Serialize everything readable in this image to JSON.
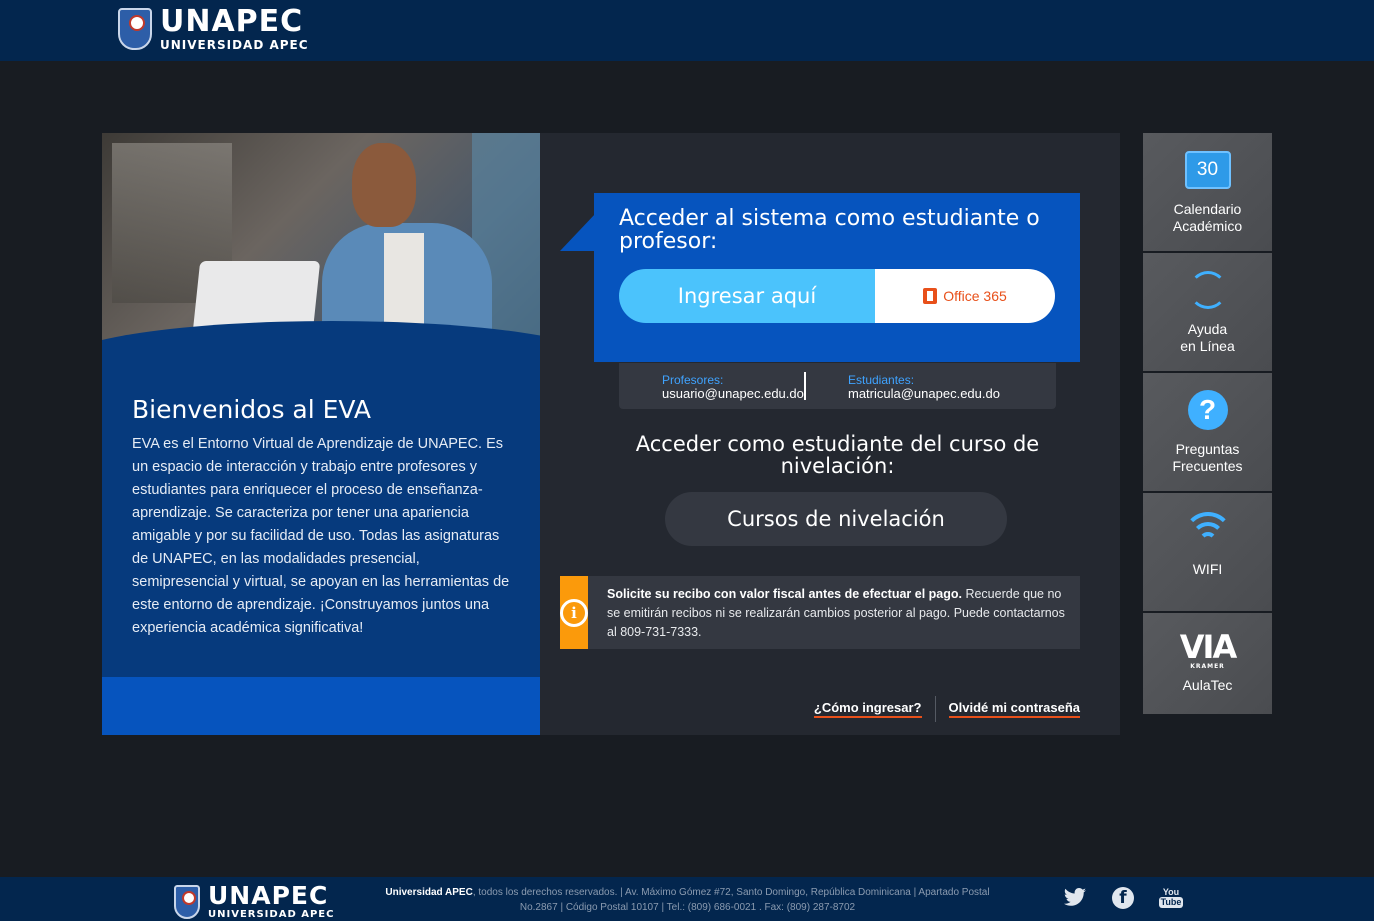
{
  "header": {
    "logo_big": "UNAPEC",
    "logo_small": "UNIVERSIDAD APEC"
  },
  "welcome": {
    "title": "Bienvenidos al EVA",
    "text": "EVA es el Entorno Virtual de Aprendizaje de UNAPEC. Es un espacio de interacción y trabajo entre profesores y estudiantes para enriquecer el proceso de enseñanza-aprendizaje. Se caracteriza por tener una apariencia amigable y por su facilidad de uso. Todas las asignaturas de UNAPEC, en las modalidades presencial, semipresencial y virtual, se apoyan en las herramientas de este entorno de aprendizaje. ¡Construyamos juntos una experiencia académica significativa!"
  },
  "login": {
    "title": "Acceder al sistema como estudiante o profesor:",
    "ingresar_label": "Ingresar aquí",
    "office_label": "Office 365",
    "hint_prof_label": "Profesores:",
    "hint_prof_value": "usuario@unapec.edu.do",
    "hint_est_label": "Estudiantes:",
    "hint_est_value": "matricula@unapec.edu.do"
  },
  "level": {
    "title": "Acceder como estudiante del curso de nivelación:",
    "button_label": "Cursos de nivelación"
  },
  "notice": {
    "bold": "Solicite su recibo con valor fiscal antes de efectuar el pago.",
    "text": " Recuerde que no se emitirán recibos ni se realizarán cambios posterior al pago. Puede contactarnos al 809-731-7333."
  },
  "links": {
    "how_to": "¿Cómo ingresar?",
    "forgot": "Olvidé mi contraseña"
  },
  "sidebar": {
    "items": [
      {
        "icon": "calendar-icon",
        "icon_text": "30",
        "label1": "Calendario",
        "label2": "Académico"
      },
      {
        "icon": "help-online-icon",
        "label1": "Ayuda",
        "label2": "en Línea"
      },
      {
        "icon": "question-icon",
        "icon_text": "?",
        "label1": "Preguntas",
        "label2": "Frecuentes"
      },
      {
        "icon": "wifi-icon",
        "label1": "WIFI",
        "label2": ""
      },
      {
        "icon": "via-kramer-icon",
        "icon_text": "VIA",
        "icon_sub": "KRAMER",
        "label1": "AulaTec",
        "label2": ""
      }
    ]
  },
  "footer": {
    "logo_big": "UNAPEC",
    "logo_small": "UNIVERSIDAD APEC",
    "org": "Universidad APEC",
    "line1": ", todos los derechos reservados. | Av. Máximo Gómez #72, Santo Domingo, República Dominicana | Apartado Postal",
    "line2": "No.2867 | Código Postal 10107 | Tel.: (809) 686-0021 . Fax: (809) 287-8702",
    "youtube_you": "You",
    "youtube_tube": "Tube",
    "facebook_glyph": "f"
  },
  "colors": {
    "header_bg": "#03264e",
    "page_bg": "#181c22",
    "panel_bg": "#242830",
    "brand_blue": "#0654be",
    "accent_light_blue": "#4bc3fc",
    "office_orange": "#e8501a",
    "notice_orange": "#fb9a0b"
  }
}
